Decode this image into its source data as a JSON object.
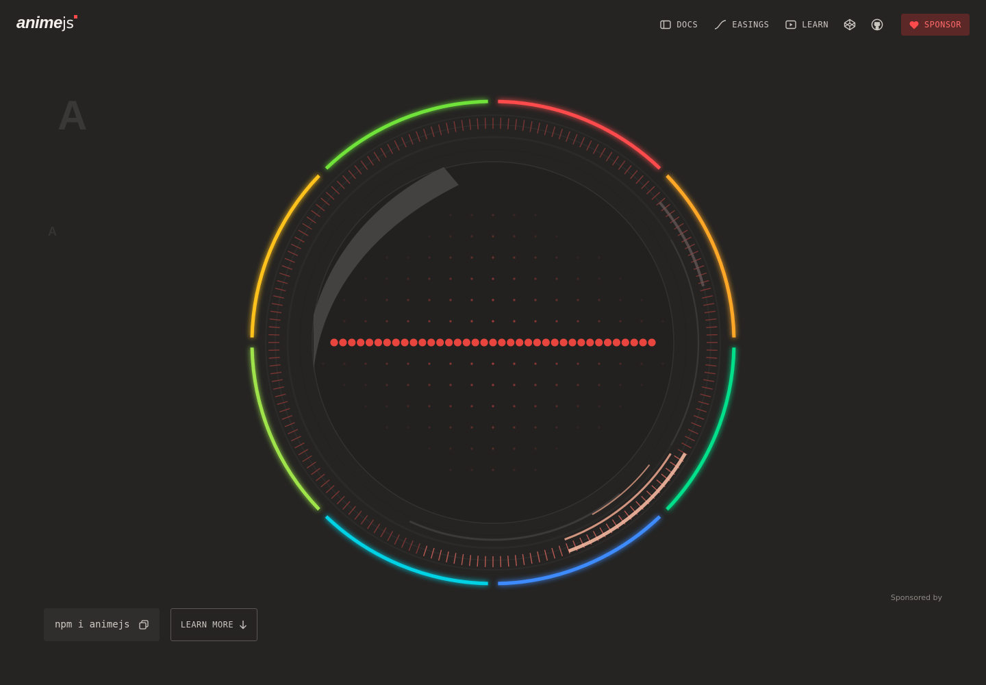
{
  "logo": {
    "word": "anime",
    "suffix": "js"
  },
  "nav": {
    "docs": "DOCS",
    "easings": "EASINGS",
    "learn": "LEARN",
    "sponsor": "SPONSOR"
  },
  "icons": {
    "docs": "sidebar-panel-icon",
    "easings": "easing-curve-icon",
    "learn": "play-icon",
    "codepen": "codepen-icon",
    "github": "github-icon",
    "sponsor": "heart-icon"
  },
  "hero": {
    "ghost_letter": "A",
    "ghost_letter_small": "A"
  },
  "sponsored_by": "Sponsored by",
  "install": {
    "command": "npm i animejs"
  },
  "learn_more": "LEARN MORE",
  "colors": {
    "accent": "#ff4b4b",
    "ring": [
      "#ff4b4b",
      "#ffa726",
      "#00e08a",
      "#3d8bff",
      "#00d2e6",
      "#9ee34a",
      "#ffc21a",
      "#6fe33a"
    ]
  }
}
